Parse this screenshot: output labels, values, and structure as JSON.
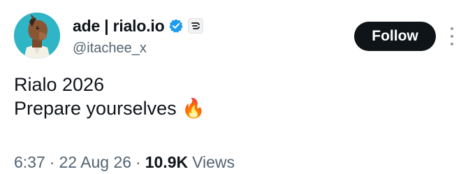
{
  "author": {
    "display_name": "ade | rialo.io",
    "handle": "@itachee_x",
    "avatar_icon": "horse-avatar-icon",
    "verified_icon": "verified-badge-icon",
    "verified_color": "#1d9bf0",
    "affiliate_icon": "affiliate-badge-icon"
  },
  "actions": {
    "follow_label": "Follow",
    "more_icon": "more-vertical-icon"
  },
  "tweet": {
    "lines": [
      "Rialo 2026",
      "Prepare yourselves"
    ],
    "emoji": "🔥",
    "time": "6:37",
    "date": "22 Aug 26",
    "separator": "·",
    "views_count": "10.9K",
    "views_label": "Views"
  },
  "colors": {
    "text_primary": "#0f1419",
    "text_secondary": "#536471",
    "button_bg": "#0f1419",
    "avatar_bg": "#2fb5c5"
  }
}
